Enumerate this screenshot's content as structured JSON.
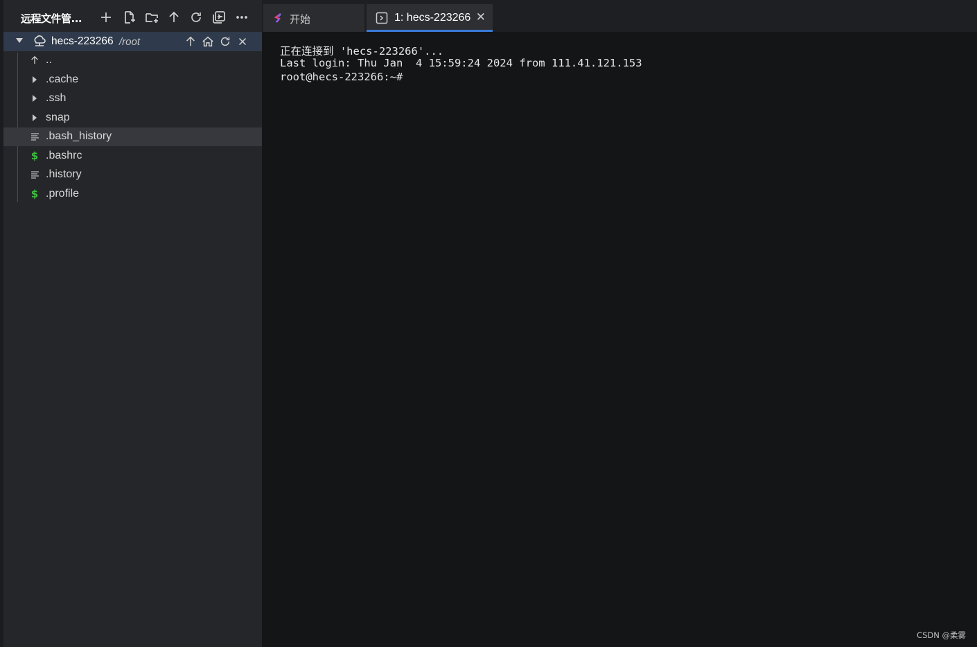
{
  "sidebar": {
    "title": "远程文件管...",
    "toolbar_icons": [
      "plus-icon",
      "new-file-icon",
      "new-folder-icon",
      "arrow-up-icon",
      "refresh-icon",
      "collapse-icon",
      "more-icon"
    ],
    "host": {
      "name": "hecs-223266",
      "path": "/root",
      "actions": [
        "arrow-up-icon",
        "home-icon",
        "refresh-icon",
        "close-icon"
      ]
    },
    "tree": [
      {
        "label": "..",
        "kind": "parent"
      },
      {
        "label": ".cache",
        "kind": "folder"
      },
      {
        "label": ".ssh",
        "kind": "folder"
      },
      {
        "label": "snap",
        "kind": "folder"
      },
      {
        "label": ".bash_history",
        "kind": "text",
        "selected": true
      },
      {
        "label": ".bashrc",
        "kind": "shell"
      },
      {
        "label": ".history",
        "kind": "text"
      },
      {
        "label": ".profile",
        "kind": "shell"
      }
    ]
  },
  "tabs": [
    {
      "label": "开始",
      "icon": "logo-icon",
      "active": false
    },
    {
      "label": "1: hecs-223266",
      "icon": "terminal-icon",
      "active": true,
      "close": "✕"
    }
  ],
  "terminal": {
    "lines": [
      "正在连接到 'hecs-223266'...",
      "Last login: Thu Jan  4 15:59:24 2024 from 111.41.121.153",
      "root@hecs-223266:~#"
    ]
  },
  "watermark": "CSDN @柔雾",
  "colors": {
    "accent": "#3b7bd8",
    "shell_icon": "#3fbf3f",
    "host_row": "#2f3b4c"
  }
}
